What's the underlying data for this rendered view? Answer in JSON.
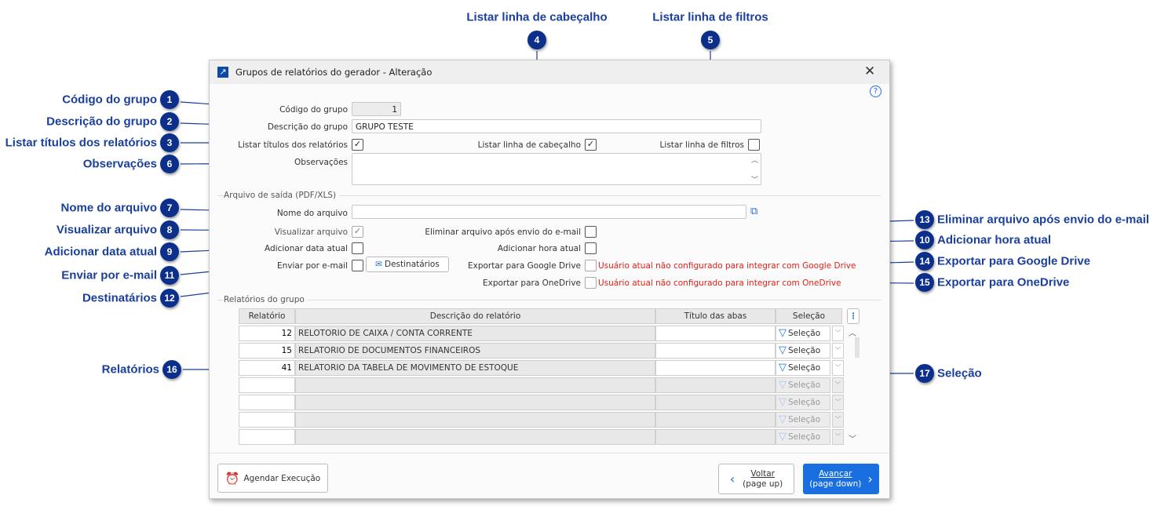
{
  "callouts": {
    "c1": {
      "num": "1",
      "label": "Código do grupo"
    },
    "c2": {
      "num": "2",
      "label": "Descrição do grupo"
    },
    "c3": {
      "num": "3",
      "label": "Listar títulos dos relatórios"
    },
    "c4": {
      "num": "4",
      "label": "Listar linha de cabeçalho"
    },
    "c5": {
      "num": "5",
      "label": "Listar linha de filtros"
    },
    "c6": {
      "num": "6",
      "label": "Observações"
    },
    "c7": {
      "num": "7",
      "label": "Nome do arquivo"
    },
    "c8": {
      "num": "8",
      "label": "Visualizar arquivo"
    },
    "c9": {
      "num": "9",
      "label": "Adicionar data atual"
    },
    "c10": {
      "num": "10",
      "label": "Adicionar hora atual"
    },
    "c11": {
      "num": "11",
      "label": "Enviar por e-mail"
    },
    "c12": {
      "num": "12",
      "label": "Destinatários"
    },
    "c13": {
      "num": "13",
      "label": "Eliminar arquivo após envio do e-mail"
    },
    "c14": {
      "num": "14",
      "label": "Exportar para Google Drive"
    },
    "c15": {
      "num": "15",
      "label": "Exportar para OneDrive"
    },
    "c16": {
      "num": "16",
      "label": "Relatórios"
    },
    "c17": {
      "num": "17",
      "label": "Seleção"
    }
  },
  "dialog": {
    "title": "Grupos de relatórios do gerador - Alteração",
    "codigo_label": "Código do grupo",
    "codigo_value": "1",
    "descricao_label": "Descrição do grupo",
    "descricao_value": "GRUPO TESTE",
    "listar_titulos_label": "Listar títulos dos relatórios",
    "listar_titulos_checked": true,
    "listar_cabecalho_label": "Listar linha de cabeçalho",
    "listar_cabecalho_checked": true,
    "listar_filtros_label": "Listar linha de filtros",
    "listar_filtros_checked": false,
    "observacoes_label": "Observações",
    "observacoes_value": "",
    "arquivo_section": "Arquivo de saída (PDF/XLS)",
    "nome_arquivo_label": "Nome do arquivo",
    "nome_arquivo_value": "",
    "visualizar_label": "Visualizar arquivo",
    "visualizar_checked": true,
    "eliminar_label": "Eliminar arquivo após envio do e-mail",
    "eliminar_checked": false,
    "data_atual_label": "Adicionar data atual",
    "data_atual_checked": false,
    "hora_atual_label": "Adicionar hora atual",
    "hora_atual_checked": false,
    "enviar_email_label": "Enviar por e-mail",
    "enviar_email_checked": false,
    "destinatarios_label": "Destinatários",
    "google_label": "Exportar para Google Drive",
    "google_msg": "Usuário atual não configurado para integrar com Google Drive",
    "onedrive_label": "Exportar para OneDrive",
    "onedrive_msg": "Usuário atual não configurado para integrar com OneDrive",
    "relatorios_section": "Relatórios do grupo",
    "columns": [
      "Relatório",
      "Descrição do relatório",
      "Título das abas",
      "Seleção"
    ],
    "rows": [
      {
        "id": "12",
        "desc": "RELOTORIO DE CAIXA / CONTA CORRENTE",
        "titulo": "",
        "sel": "Seleção"
      },
      {
        "id": "15",
        "desc": "RELATORIO DE DOCUMENTOS FINANCEIROS",
        "titulo": "",
        "sel": "Seleção"
      },
      {
        "id": "41",
        "desc": "RELATORIO DA TABELA DE MOVIMENTO DE ESTOQUE",
        "titulo": "",
        "sel": "Seleção"
      },
      {
        "id": "",
        "desc": "",
        "titulo": "",
        "sel": "Seleção"
      },
      {
        "id": "",
        "desc": "",
        "titulo": "",
        "sel": "Seleção"
      },
      {
        "id": "",
        "desc": "",
        "titulo": "",
        "sel": "Seleção"
      },
      {
        "id": "",
        "desc": "",
        "titulo": "",
        "sel": "Seleção"
      }
    ],
    "agendar_label": "Agendar Execução",
    "voltar_label": "Voltar",
    "voltar_sub": "(page up)",
    "avancar_label": "Avançar",
    "avancar_sub": "(page down)",
    "accent": "#1a6fe0",
    "callout_color": "#0b2f8a",
    "warning_color": "#e0221a"
  }
}
